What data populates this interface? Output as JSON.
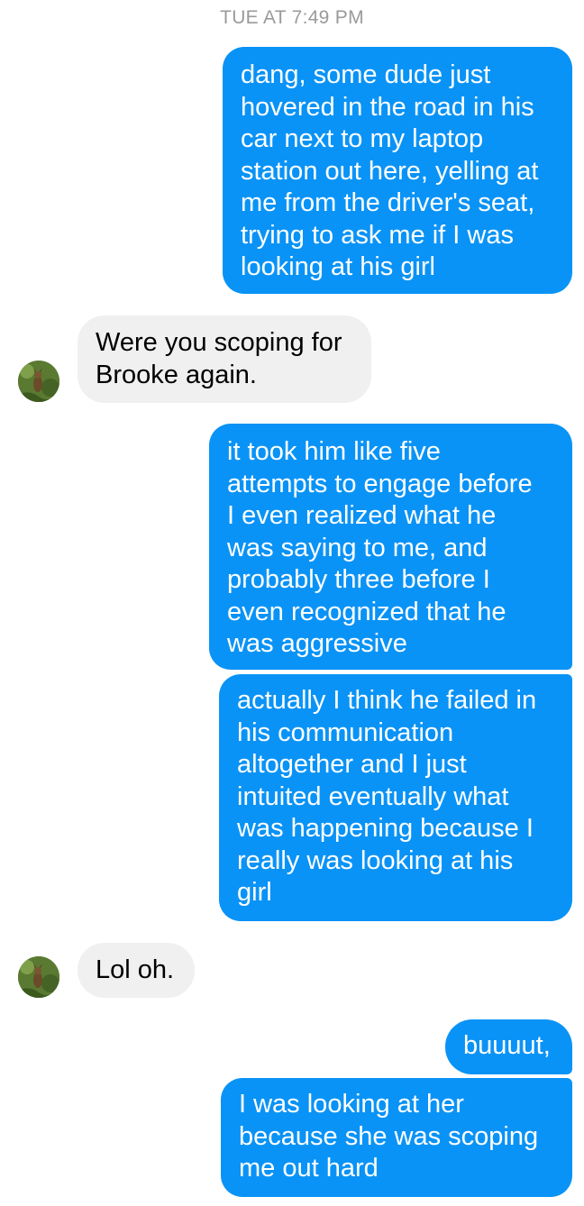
{
  "conversation": {
    "timestamp": "TUE AT 7:49 PM",
    "messages": [
      {
        "sender": "me",
        "text": "dang, some dude just\nhovered in the road in his\ncar next to my laptop\nstation out here, yelling at\nme from the driver's seat,\ntrying to ask me if I was\nlooking at his girl"
      },
      {
        "sender": "them",
        "text": "Were you scoping for\nBrooke again."
      },
      {
        "sender": "me",
        "text": "it took him like five\nattempts to engage before\nI even realized what he\nwas saying to me, and\nprobably three before I\neven recognized that he\nwas aggressive"
      },
      {
        "sender": "me",
        "text": "actually I think he failed in\nhis communication\naltogether and I just\nintuited eventually what\nwas happening because I\nreally was looking at his\ngirl"
      },
      {
        "sender": "them",
        "text": "Lol oh."
      },
      {
        "sender": "me",
        "text": "buuuut,"
      },
      {
        "sender": "me",
        "text": "I was looking at her\nbecause she was scoping\nme out hard"
      }
    ]
  },
  "colors": {
    "outgoing_bubble": "#0a93f6",
    "incoming_bubble": "#f0f0f0",
    "timestamp_text": "#9a9a9a"
  },
  "icons": {
    "contact_avatar": "avatar-photo"
  }
}
